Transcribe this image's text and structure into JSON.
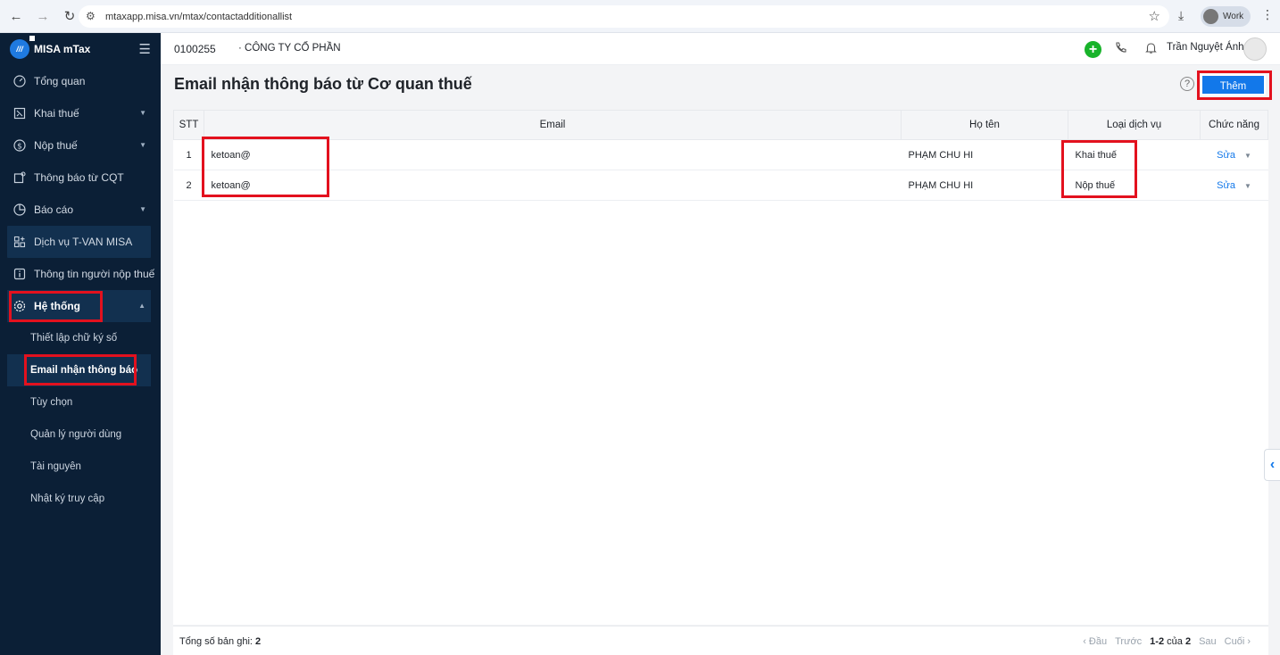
{
  "browser": {
    "url": "mtaxapp.misa.vn/mtax/contactadditionallist",
    "profile": "Work"
  },
  "sidebar": {
    "brand": "MISA mTax",
    "items": [
      {
        "label": "Tổng quan"
      },
      {
        "label": "Khai thuế"
      },
      {
        "label": "Nộp thuế"
      },
      {
        "label": "Thông báo từ CQT"
      },
      {
        "label": "Báo cáo"
      },
      {
        "label": "Dịch vụ T-VAN MISA"
      },
      {
        "label": "Thông tin người nộp thuế"
      },
      {
        "label": "Hệ thống"
      }
    ],
    "sub_items": [
      {
        "label": "Thiết lập chữ ký số"
      },
      {
        "label": "Email nhận thông báo"
      },
      {
        "label": "Tùy chọn"
      },
      {
        "label": "Quản lý người dùng"
      },
      {
        "label": "Tài nguyên"
      },
      {
        "label": "Nhật ký truy cập"
      }
    ]
  },
  "header": {
    "tax_code": "0100255",
    "company": "· CÔNG TY CỔ PHẦN",
    "user_name": "Trần Nguyệt Ánh"
  },
  "page": {
    "title": "Email nhận thông báo từ Cơ quan thuế",
    "add_label": "Thêm",
    "help": "?"
  },
  "table": {
    "columns": [
      "STT",
      "Email",
      "Họ tên",
      "Loại dịch vụ",
      "Chức năng"
    ],
    "rows": [
      {
        "stt": "1",
        "email": "ketoan@",
        "name": "PHẠM CHU HI",
        "service": "Khai thuế",
        "action": "Sửa"
      },
      {
        "stt": "2",
        "email": "ketoan@",
        "name": "PHẠM CHU HI",
        "service": "Nộp thuế",
        "action": "Sửa"
      }
    ]
  },
  "footer": {
    "total_label": "Tổng số bản ghi:",
    "total_value": "2",
    "first": "‹ Đầu",
    "prev": "Trước",
    "range_bold": "1-2",
    "range_of": "của",
    "range_total": "2",
    "next": "Sau",
    "last": "Cuối ›"
  }
}
